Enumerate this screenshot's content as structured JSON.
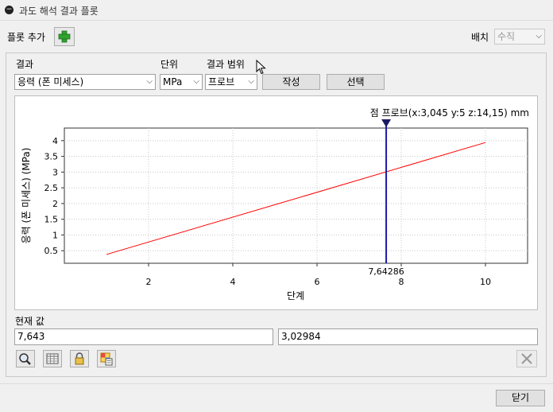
{
  "window": {
    "title": "과도 해석 결과 플롯"
  },
  "toolbar": {
    "add_plot_label": "플롯 추가",
    "layout_label": "배치",
    "layout_value": "수직"
  },
  "controls": {
    "result_label": "결과",
    "result_value": "응력 (폰 미세스)",
    "unit_label": "단위",
    "unit_value": "MPa",
    "range_label": "결과 범위",
    "range_value": "프로브",
    "create_button": "작성",
    "select_button": "선택"
  },
  "current": {
    "label": "현재 값",
    "x_value": "7,643",
    "y_value": "3,02984"
  },
  "footer": {
    "close_button": "닫기"
  },
  "chart_data": {
    "type": "line",
    "probe_label": "점 프로브(x:3,045 y:5 z:14,15) mm",
    "xlabel": "단계",
    "ylabel": "응력 (폰 미세스) (MPa)",
    "xlim": [
      0,
      11
    ],
    "ylim": [
      0.1,
      4.4
    ],
    "xticks": [
      "2",
      "4",
      "6",
      "8",
      "10"
    ],
    "yticks": [
      "0.5",
      "1",
      "1.5",
      "2",
      "2.5",
      "3",
      "3.5",
      "4"
    ],
    "marker_x": 7.64286,
    "marker_label": "7,64286",
    "series": [
      {
        "color": "#ff0000",
        "x": [
          1,
          10
        ],
        "y": [
          0.38,
          3.94
        ]
      }
    ]
  }
}
